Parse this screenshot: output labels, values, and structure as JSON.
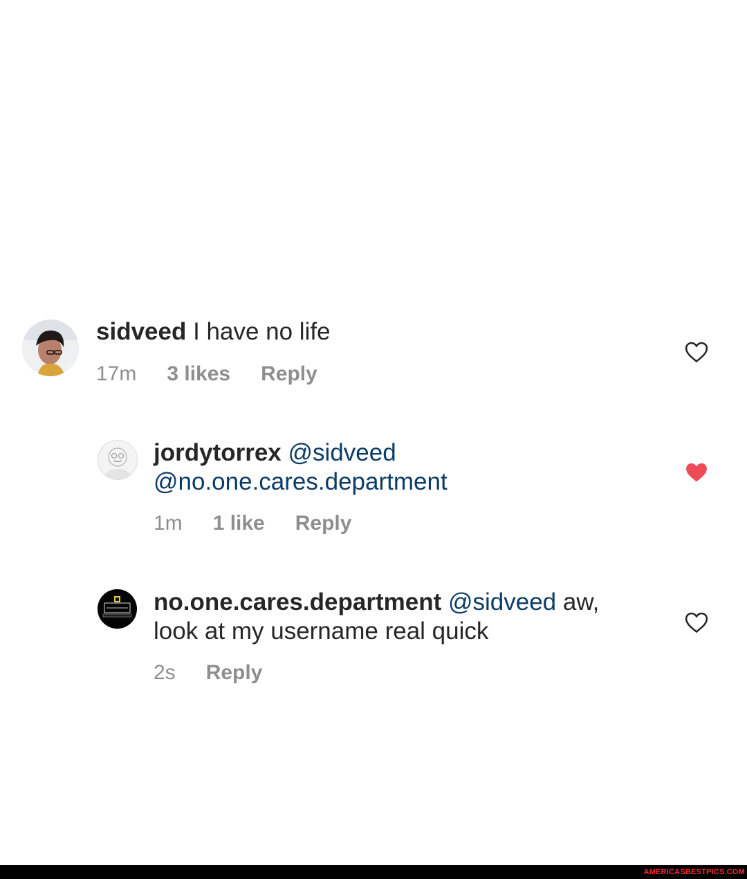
{
  "comments": [
    {
      "username": "sidveed",
      "text": " I have no life",
      "time": "17m",
      "likes": "3 likes",
      "reply": "Reply",
      "liked": false
    },
    {
      "username": "jordytorrex",
      "mention1": "@sidveed",
      "mention2": "@no.one.cares.department",
      "time": "1m",
      "likes": "1 like",
      "reply": "Reply",
      "liked": true
    },
    {
      "username": "no.one.cares.department",
      "mention1": "@sidveed",
      "text_line1_tail": " aw,",
      "text_line2": "look at my username real quick",
      "time": "2s",
      "reply": "Reply",
      "liked": false
    }
  ],
  "colors": {
    "text": "#262626",
    "meta": "#8e8e8e",
    "mention": "#0b3b66",
    "heart_liked": "#ed4956",
    "heart_outline": "#262626"
  },
  "icons": {
    "like": "heart-outline-icon",
    "liked": "heart-filled-icon"
  },
  "watermark": "AMERICASBESTPICS.COM"
}
